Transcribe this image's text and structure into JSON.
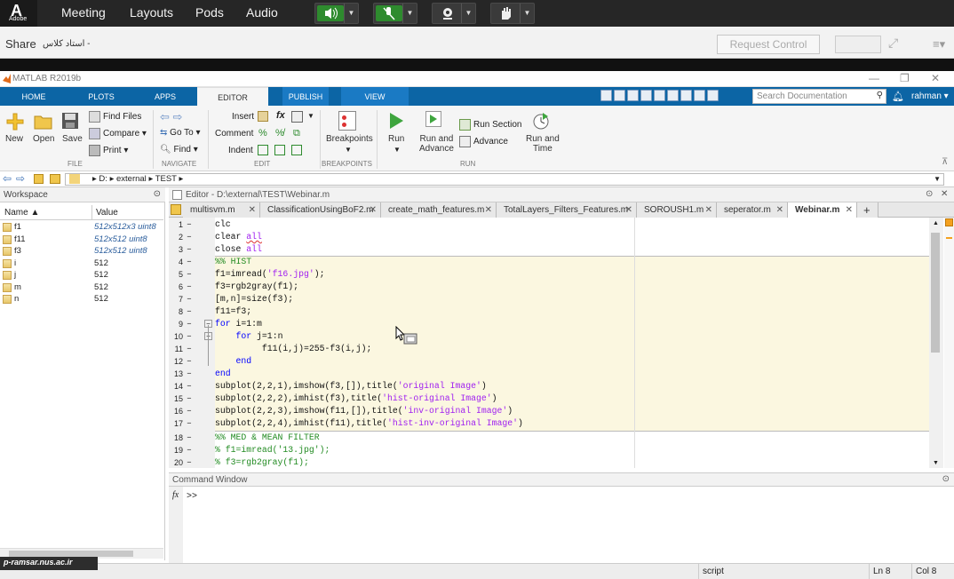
{
  "connect": {
    "logo": "Adobe",
    "menus": [
      "Meeting",
      "Layouts",
      "Pods",
      "Audio"
    ],
    "share_title": "Share",
    "share_subtitle": "استاد کلاس -",
    "request_control": "Request Control"
  },
  "matlab": {
    "title": "MATLAB R2019b",
    "tabs": [
      "HOME",
      "PLOTS",
      "APPS",
      "EDITOR",
      "PUBLISH",
      "VIEW"
    ],
    "search_placeholder": "Search Documentation",
    "user": "rahman ▾"
  },
  "ribbon": {
    "file": {
      "new": "New",
      "open": "Open",
      "save": "Save",
      "find_files": "Find Files",
      "compare": "Compare",
      "print": "Print",
      "label": "FILE"
    },
    "navigate": {
      "goto": "Go To",
      "find": "Find",
      "label": "NAVIGATE"
    },
    "edit": {
      "insert": "Insert",
      "comment": "Comment",
      "indent": "Indent",
      "label": "EDIT"
    },
    "breakpoints": {
      "breakpoints": "Breakpoints",
      "label": "BREAKPOINTS"
    },
    "run": {
      "run": "Run",
      "run_and_advance": "Run and",
      "run_and_advance2": "Advance",
      "run_section": "Run Section",
      "advance": "Advance",
      "run_and_time": "Run and",
      "run_and_time2": "Time",
      "label": "RUN"
    }
  },
  "address": {
    "path": [
      "D:",
      "external",
      "TEST"
    ]
  },
  "workspace": {
    "title": "Workspace",
    "col_name": "Name ▲",
    "col_value": "Value",
    "vars": [
      {
        "name": "f1",
        "value": "512x512x3 uint8",
        "blue": true
      },
      {
        "name": "f11",
        "value": "512x512 uint8",
        "blue": true
      },
      {
        "name": "f3",
        "value": "512x512 uint8",
        "blue": true
      },
      {
        "name": "i",
        "value": "512",
        "blue": false
      },
      {
        "name": "j",
        "value": "512",
        "blue": false
      },
      {
        "name": "m",
        "value": "512",
        "blue": false
      },
      {
        "name": "n",
        "value": "512",
        "blue": false
      }
    ]
  },
  "editor": {
    "title": "Editor - D:\\external\\TEST\\Webinar.m",
    "tabs": [
      "multisvm.m",
      "ClassificationUsingBoF2.m",
      "create_math_features.m",
      "TotalLayers_Filters_Features.m",
      "SOROUSH1.m",
      "seperator.m",
      "Webinar.m",
      "+"
    ],
    "line_numbers": [
      "1",
      "2",
      "3",
      "4",
      "5",
      "6",
      "7",
      "8",
      "9",
      "10",
      "11",
      "12",
      "13",
      "14",
      "15",
      "16",
      "17",
      "18",
      "19",
      "20"
    ]
  },
  "command": {
    "title": "Command Window",
    "prompt": ">>",
    "fx": "fx"
  },
  "status": {
    "mode": "script",
    "ln": "Ln  8",
    "col": "Col  8"
  },
  "watermark": "p-ramsar.nus.ac.ir"
}
